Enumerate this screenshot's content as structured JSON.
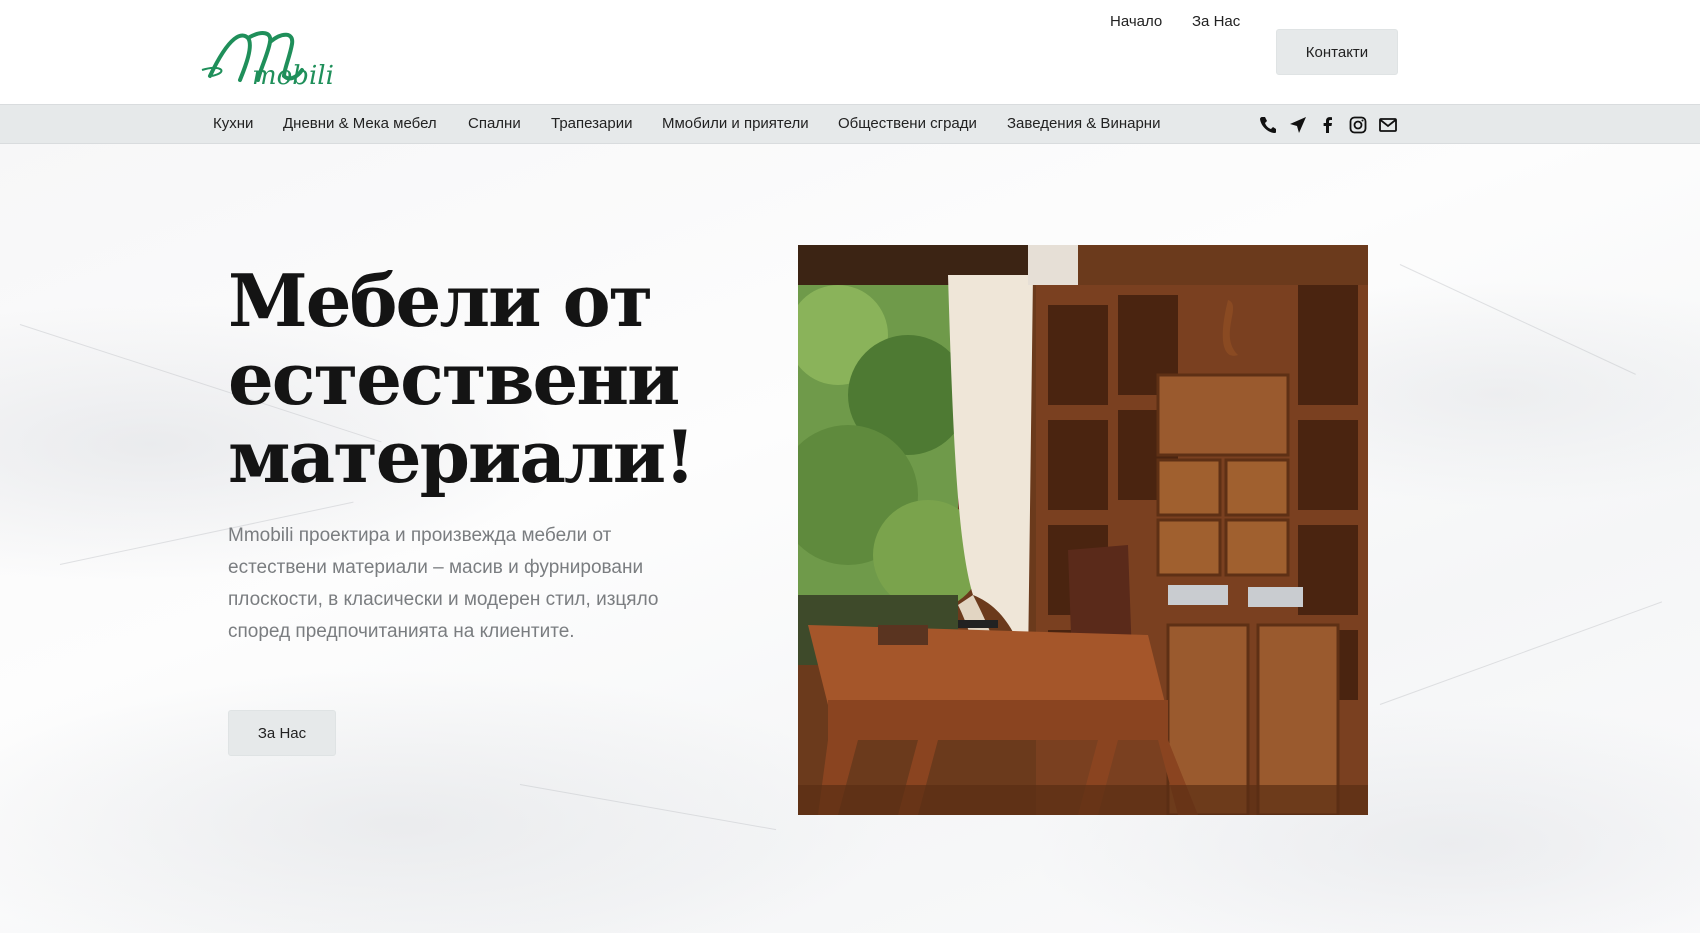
{
  "brand": {
    "logo_mark": "M",
    "logo_text": "mobili",
    "color": "#1f8f5a"
  },
  "top_nav": {
    "home": "Начало",
    "about": "За Нас",
    "contacts": "Контакти"
  },
  "categories": [
    "Кухни",
    "Дневни & Мека мебел",
    "Спални",
    "Трапезарии",
    "Ммобили и приятели",
    "Обществени сгради",
    "Заведения & Винарни"
  ],
  "social_icons": [
    "phone-icon",
    "location-arrow-icon",
    "facebook-icon",
    "instagram-icon",
    "mail-icon"
  ],
  "hero": {
    "title": "Мебели от естествени материали!",
    "lead": "Mmobili проектира и произвежда мебели от естествени материали – масив и фурнировани плоскости, в класически и модерен стил, изцяло според предпочитанията на клиентите.",
    "button": "За Нас"
  },
  "colors": {
    "bar_bg": "#e6e9ea",
    "text": "#141414",
    "muted": "#7a7d80",
    "wood": "#8a4a22"
  }
}
